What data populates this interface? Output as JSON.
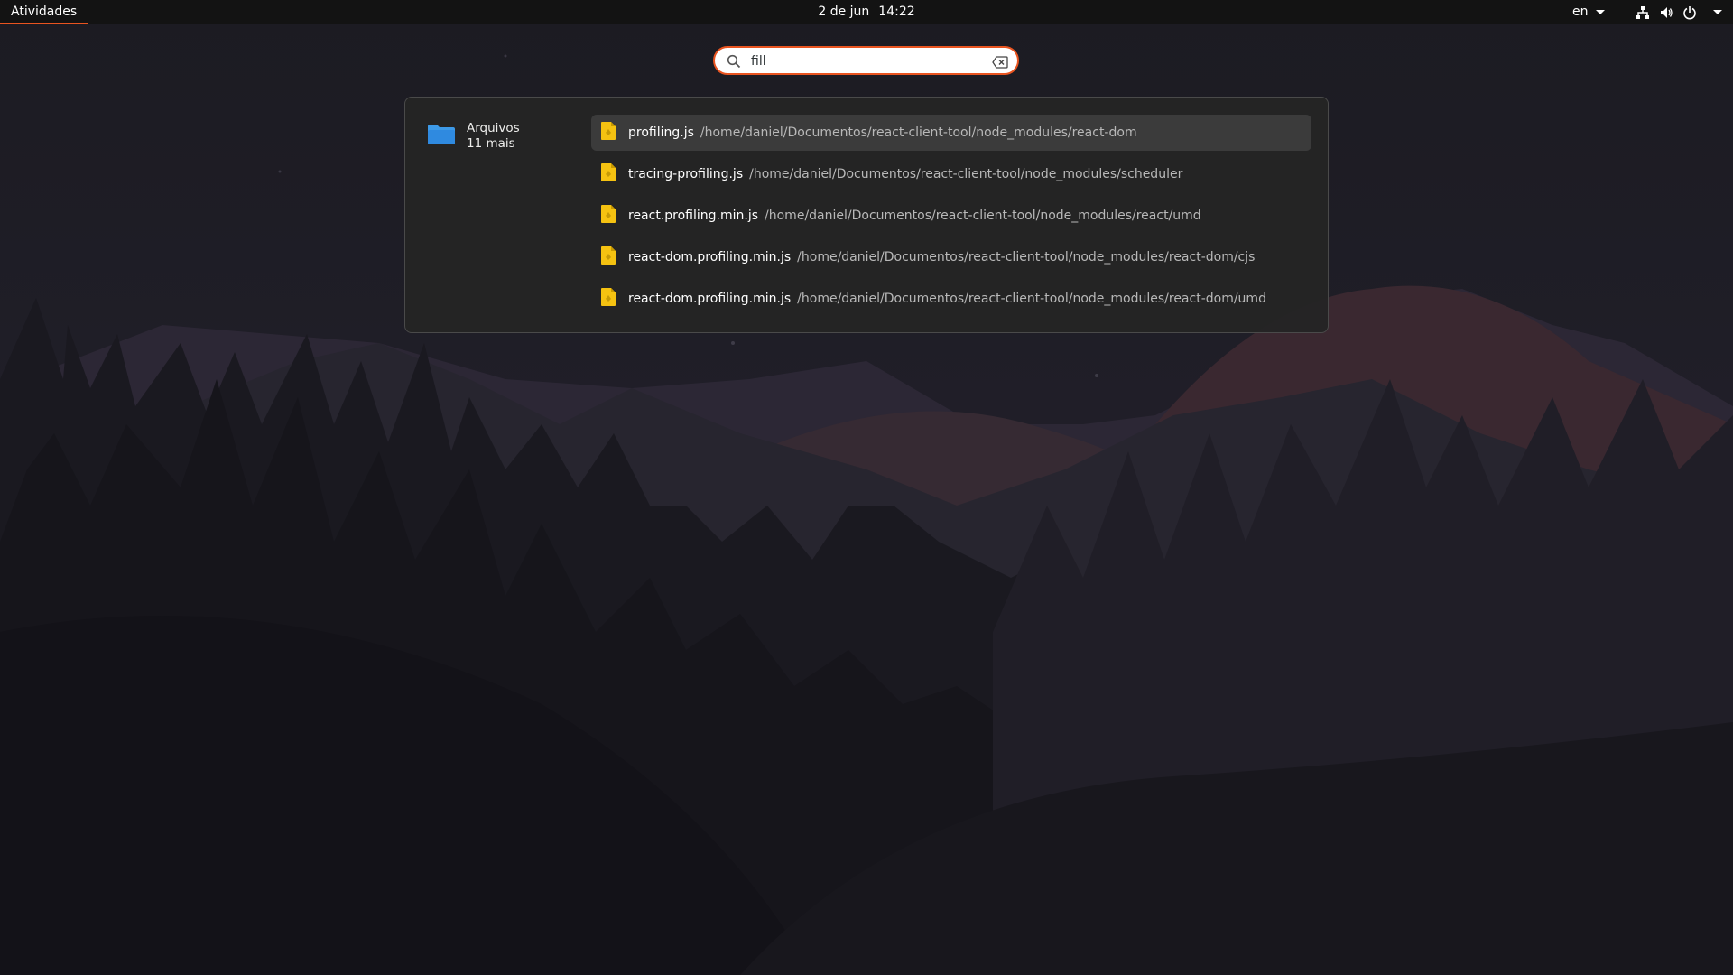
{
  "topbar": {
    "activities_label": "Atividades",
    "date": "2 de jun",
    "time": "14:22",
    "keyboard_layout": "en",
    "icons": [
      "network-icon",
      "volume-icon",
      "power-icon",
      "chevron-down-icon"
    ]
  },
  "search": {
    "value": "fill",
    "placeholder": "",
    "icon": "search-icon",
    "clear_icon": "clear-icon"
  },
  "provider": {
    "name": "Arquivos",
    "more": "11 mais",
    "icon": "folder-icon"
  },
  "results": [
    {
      "name": "profiling.js",
      "path": "/home/daniel/Documentos/react-client-tool/node_modules/react-dom",
      "selected": true
    },
    {
      "name": "tracing-profiling.js",
      "path": "/home/daniel/Documentos/react-client-tool/node_modules/scheduler",
      "selected": false
    },
    {
      "name": "react.profiling.min.js",
      "path": "/home/daniel/Documentos/react-client-tool/node_modules/react/umd",
      "selected": false
    },
    {
      "name": "react-dom.profiling.min.js",
      "path": "/home/daniel/Documentos/react-client-tool/node_modules/react-dom/cjs",
      "selected": false
    },
    {
      "name": "react-dom.profiling.min.js",
      "path": "/home/daniel/Documentos/react-client-tool/node_modules/react-dom/umd",
      "selected": false
    }
  ],
  "colors": {
    "accent": "#e95420",
    "file_icon": "#f5c211",
    "folder_icon": "#3d9ae8",
    "panel_bg": "#242424"
  }
}
